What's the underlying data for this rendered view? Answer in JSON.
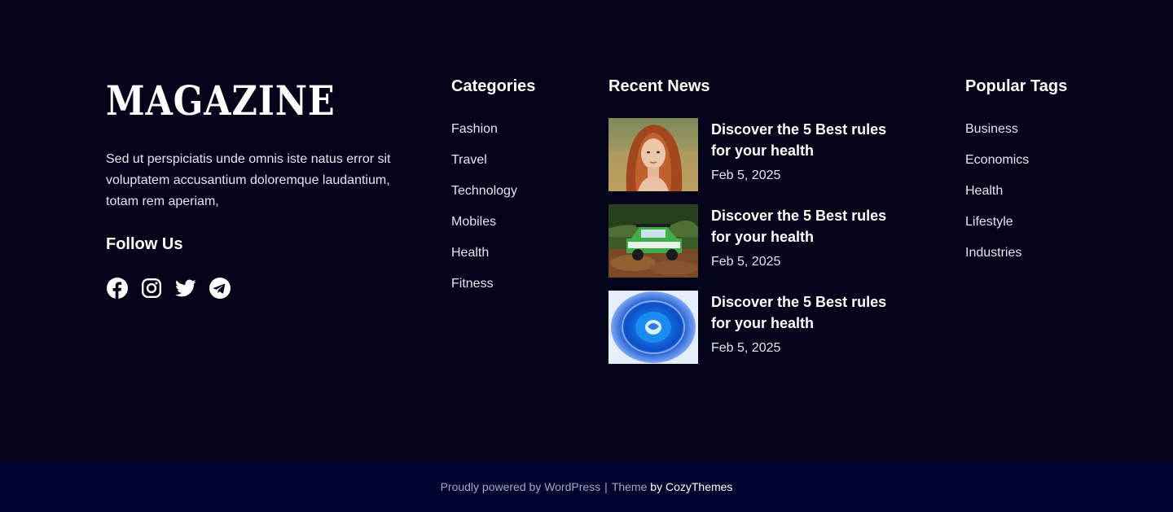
{
  "brand": {
    "logo": "MAGAZINE",
    "about": "Sed ut perspiciatis unde omnis iste natus error sit voluptatem accusantium doloremque laudantium, totam rem aperiam,",
    "follow_title": "Follow Us",
    "socials": [
      "facebook-icon",
      "instagram-icon",
      "twitter-icon",
      "telegram-icon"
    ]
  },
  "categories": {
    "title": "Categories",
    "items": [
      "Fashion",
      "Travel",
      "Technology",
      "Mobiles",
      "Health",
      "Fitness"
    ]
  },
  "recent_news": {
    "title": "Recent News",
    "items": [
      {
        "title": "Discover the 5 Best rules for your health",
        "date": "Feb 5, 2025"
      },
      {
        "title": "Discover the 5 Best rules for your health",
        "date": "Feb 5, 2025"
      },
      {
        "title": "Discover the 5 Best rules for your health",
        "date": "Feb 5, 2025"
      }
    ]
  },
  "popular_tags": {
    "title": "Popular Tags",
    "items": [
      "Business",
      "Economics",
      "Health",
      "Lifestyle",
      "Industries"
    ]
  },
  "bottom_bar": {
    "powered": "Proudly powered by WordPress",
    "separator": "|",
    "theme_label": "Theme",
    "theme_author": "by CozyThemes"
  },
  "colors": {
    "background": "#03031a",
    "bottom_bar": "#00032e",
    "text": "#ffffff"
  }
}
